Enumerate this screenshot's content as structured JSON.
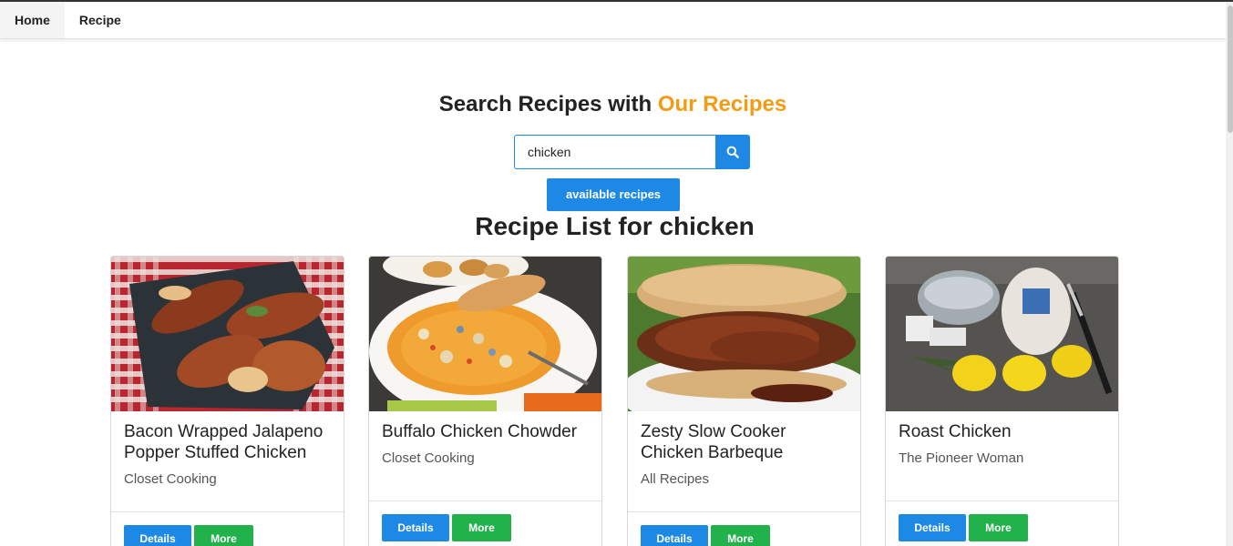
{
  "nav": {
    "items": [
      {
        "label": "Home",
        "active": true
      },
      {
        "label": "Recipe",
        "active": false
      }
    ]
  },
  "header": {
    "title_prefix": "Search Recipes with",
    "title_accent": "Our Recipes",
    "accent_color": "#f39c12"
  },
  "search": {
    "value": "chicken",
    "button_icon": "search-icon"
  },
  "available_button": "available recipes",
  "list_title": "Recipe List for chicken",
  "recipes": [
    {
      "title": "Bacon Wrapped Jalapeno Popper Stuffed Chicken",
      "publisher": "Closet Cooking",
      "details_label": "Details",
      "more_label": "More",
      "image": "bacon-wrapped-chicken-photo"
    },
    {
      "title": "Buffalo Chicken Chowder",
      "publisher": "Closet Cooking",
      "details_label": "Details",
      "more_label": "More",
      "image": "buffalo-chowder-photo"
    },
    {
      "title": "Zesty Slow Cooker Chicken Barbeque",
      "publisher": "All Recipes",
      "details_label": "Details",
      "more_label": "More",
      "image": "bbq-sandwich-photo"
    },
    {
      "title": "Roast Chicken",
      "publisher": "The Pioneer Woman",
      "details_label": "Details",
      "more_label": "More",
      "image": "roast-chicken-ingredients-photo"
    }
  ],
  "colors": {
    "primary_blue": "#1e88e5",
    "more_green": "#22b24c"
  }
}
